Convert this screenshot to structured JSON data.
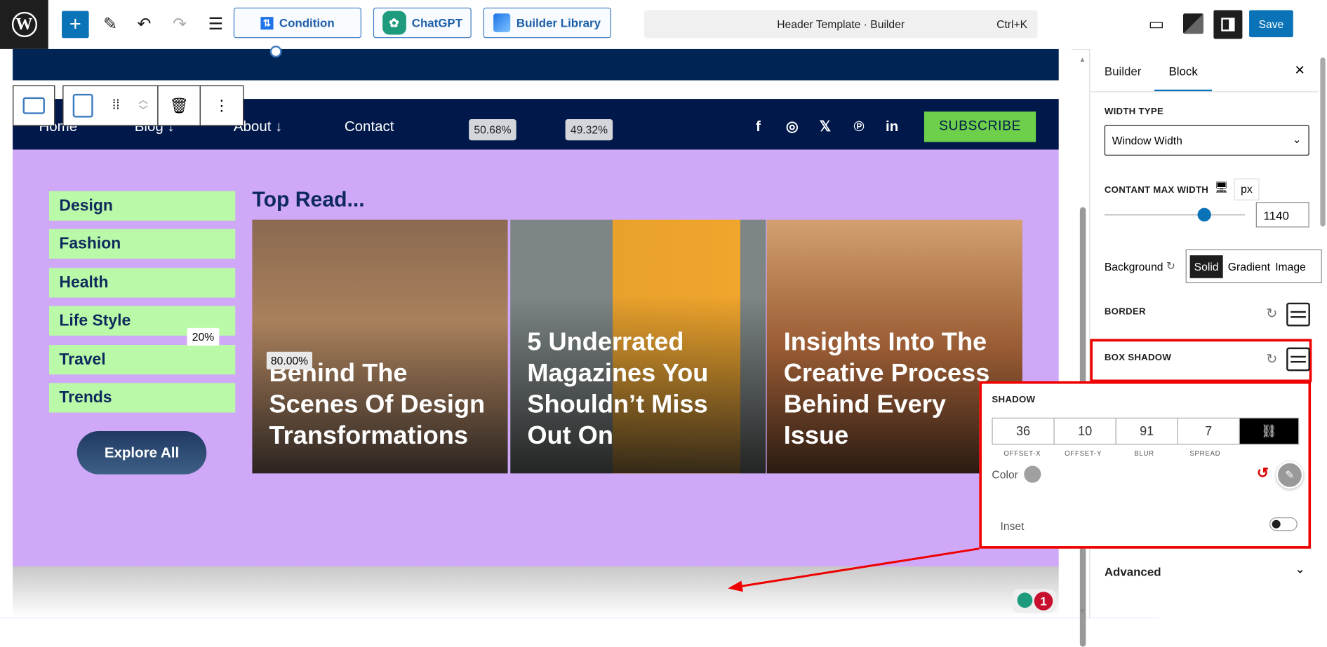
{
  "toolbar": {
    "condition": "Condition",
    "chatgpt": "ChatGPT",
    "library": "Builder Library",
    "command_title": "Header Template · Builder",
    "shortcut": "Ctrl+K",
    "save": "Save"
  },
  "nav": {
    "items": [
      "Home",
      "Blog ↓",
      "About ↓",
      "Contact"
    ],
    "pct_left": "50.68%",
    "pct_right": "49.32%",
    "subscribe": "SUBSCRIBE",
    "social": [
      "facebook-icon",
      "instagram-icon",
      "x-icon",
      "pinterest-icon",
      "linkedin-icon"
    ]
  },
  "content": {
    "categories": [
      "Design",
      "Fashion",
      "Health",
      "Life Style",
      "Travel",
      "Trends"
    ],
    "col_pct": "20%",
    "explore": "Explore All",
    "heading": "Top Read...",
    "card_pct": "80.00%",
    "cards": [
      {
        "title": "Behind The Scenes Of Design Transformations"
      },
      {
        "title": "5 Underrated Magazines You Shouldn’t Miss Out On"
      },
      {
        "title": "Insights Into The Creative Process Behind Every Issue"
      }
    ]
  },
  "sidebar": {
    "tabs": [
      "Builder",
      "Block"
    ],
    "active_tab": "Block",
    "width_type_label": "WIDTH TYPE",
    "width_type": "Window Width",
    "max_width_label": "CONTANT MAX WIDTH",
    "unit": "px",
    "max_width": "1140",
    "slider_value": 1140,
    "background_label": "Background",
    "bg_options": [
      "Solid",
      "Gradient",
      "Image"
    ],
    "bg_active": "Solid",
    "border_label": "BORDER",
    "box_shadow_label": "BOX SHADOW",
    "advanced": "Advanced"
  },
  "shadow": {
    "title": "SHADOW",
    "values": [
      "36",
      "10",
      "91",
      "7"
    ],
    "captions": [
      "OFFSET-X",
      "OFFSET-Y",
      "BLUR",
      "SPREAD"
    ],
    "color_label": "Color",
    "color": "#a0a0a0",
    "inset_label": "Inset",
    "inset": false
  },
  "notif": {
    "count": "1"
  },
  "colors": {
    "accent": "#0a73b8",
    "highlight": "#ee0000",
    "purple": "#cfa8f8",
    "navy": "#01194a"
  }
}
